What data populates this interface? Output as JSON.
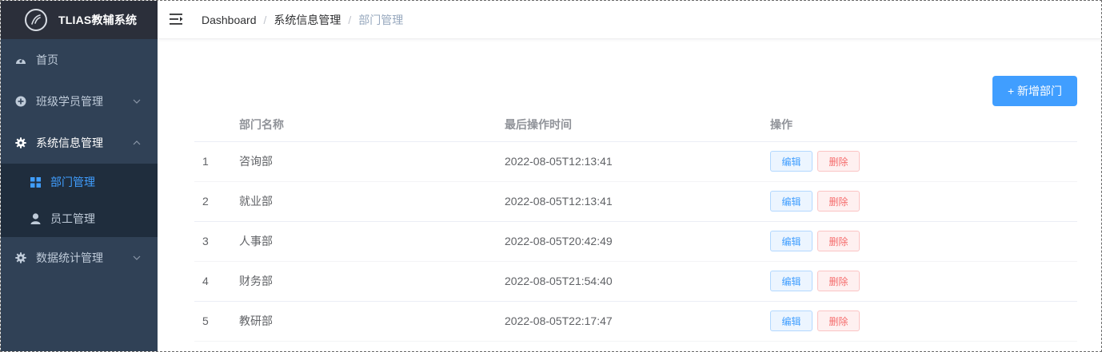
{
  "brand": {
    "title": "TLIAS教辅系统",
    "logo_icon": "logo-icon"
  },
  "sidebar": {
    "items": [
      {
        "label": "首页",
        "icon": "dashboard-icon",
        "expanded": false
      },
      {
        "label": "班级学员管理",
        "icon": "circle-plus-icon",
        "expanded": false
      },
      {
        "label": "系统信息管理",
        "icon": "gear-icon",
        "expanded": true,
        "children": [
          {
            "label": "部门管理",
            "icon": "grid-icon",
            "active": true
          },
          {
            "label": "员工管理",
            "icon": "user-icon",
            "active": false
          }
        ]
      },
      {
        "label": "数据统计管理",
        "icon": "gear-icon",
        "expanded": false
      }
    ]
  },
  "navbar": {
    "breadcrumb": [
      "Dashboard",
      "系统信息管理",
      "部门管理"
    ],
    "separator": "/"
  },
  "toolbar": {
    "add_label": "+ 新增部门"
  },
  "table": {
    "headers": [
      "",
      "部门名称",
      "最后操作时间",
      "操作"
    ],
    "rows": [
      {
        "index": "1",
        "name": "咨询部",
        "time": "2022-08-05T12:13:41"
      },
      {
        "index": "2",
        "name": "就业部",
        "time": "2022-08-05T12:13:41"
      },
      {
        "index": "3",
        "name": "人事部",
        "time": "2022-08-05T20:42:49"
      },
      {
        "index": "4",
        "name": "财务部",
        "time": "2022-08-05T21:54:40"
      },
      {
        "index": "5",
        "name": "教研部",
        "time": "2022-08-05T22:17:47"
      }
    ],
    "edit_label": "编辑",
    "delete_label": "删除"
  },
  "colors": {
    "sidebar_bg": "#304156",
    "accent": "#409eff",
    "danger": "#f56c6c"
  }
}
